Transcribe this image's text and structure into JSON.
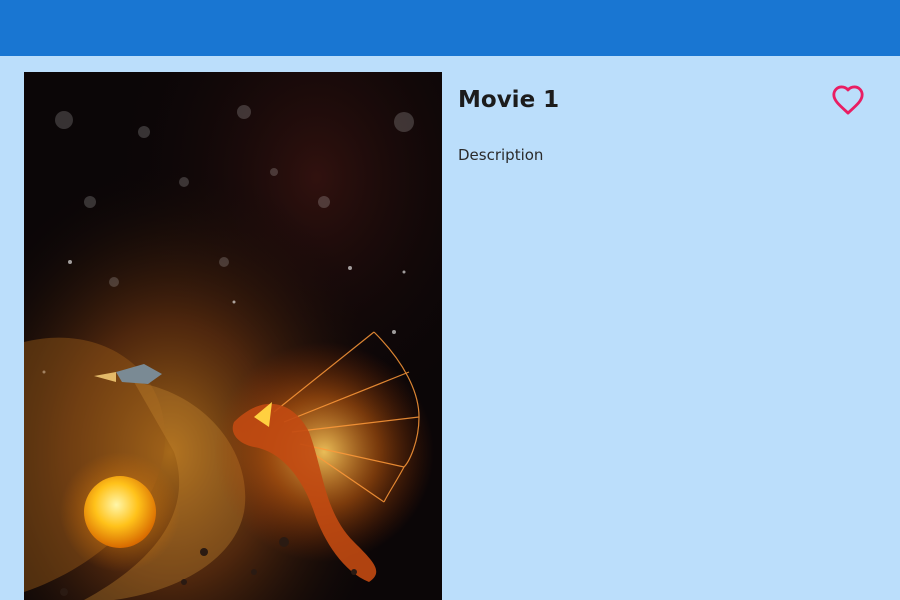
{
  "movie": {
    "title": "Movie 1",
    "description": "Description",
    "favorite_icon": "heart-outline-icon",
    "poster_alt": "Space creature poster"
  },
  "colors": {
    "app_bar": "#1976d2",
    "background": "#bbdefb",
    "favorite": "#e91e63"
  }
}
